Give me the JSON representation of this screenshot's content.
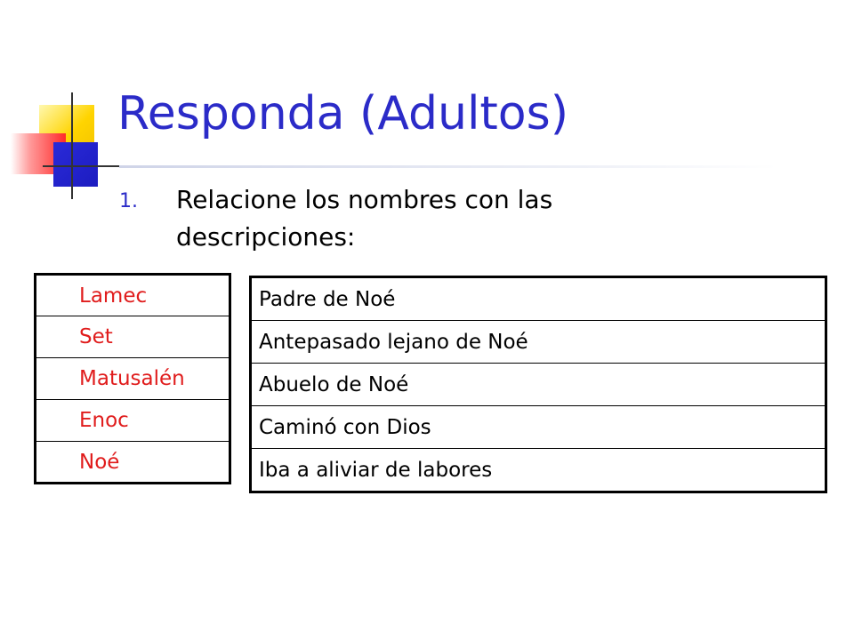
{
  "slide": {
    "title": "Responda (Adultos)",
    "item_number": "1.",
    "item_text": "Relacione los nombres con las descripciones:",
    "names": [
      "Lamec",
      "Set",
      "Matusalén",
      "Enoc",
      "Noé"
    ],
    "descriptions": [
      "Padre de Noé",
      "Antepasado lejano de Noé",
      "Abuelo de Noé",
      "Caminó con Dios",
      "Iba a aliviar de labores"
    ]
  },
  "colors": {
    "title": "#2b2bc8",
    "names_text": "#e01c1c",
    "body_text": "#000000",
    "logo_yellow": "#ffd400",
    "logo_blue": "#1c1cc0",
    "logo_red": "#ff2a2a"
  }
}
